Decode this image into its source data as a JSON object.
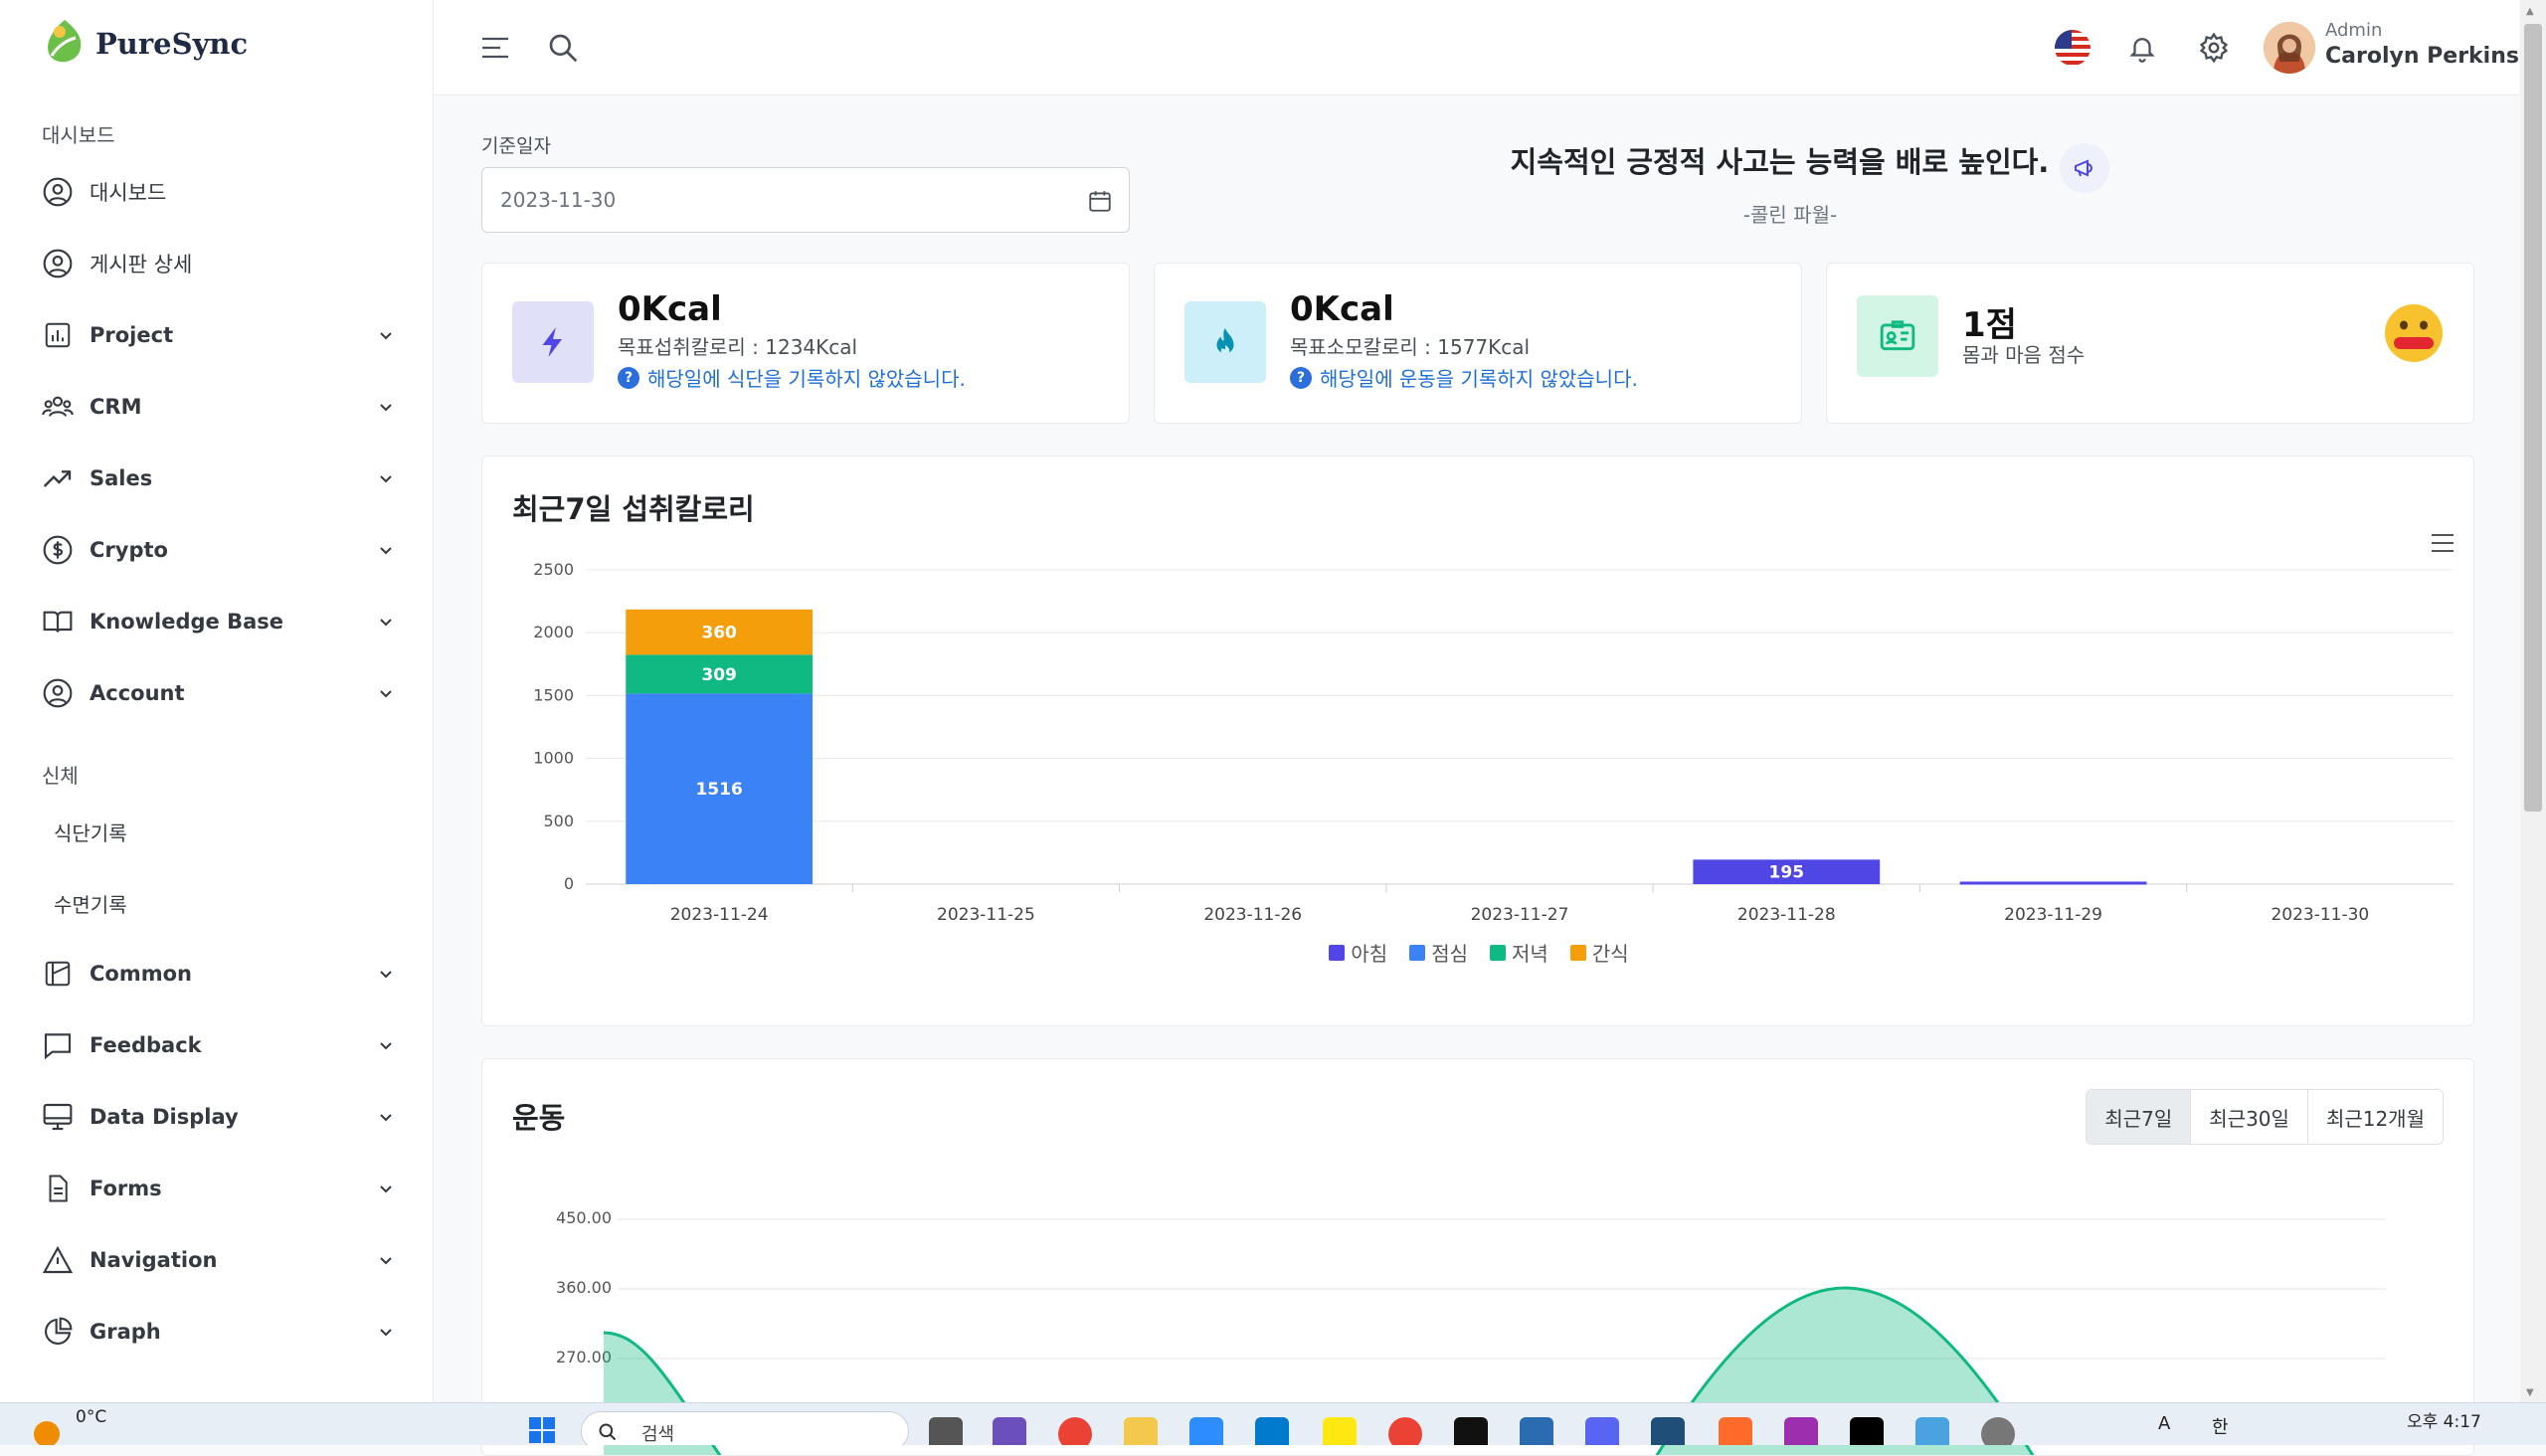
{
  "brand": {
    "name": "PureSync"
  },
  "sidebar": {
    "section1": "대시보드",
    "items1": [
      {
        "label": "대시보드"
      },
      {
        "label": "게시판 상세"
      },
      {
        "label": "Project"
      },
      {
        "label": "CRM"
      },
      {
        "label": "Sales"
      },
      {
        "label": "Crypto"
      },
      {
        "label": "Knowledge Base"
      },
      {
        "label": "Account"
      }
    ],
    "section2": "신체",
    "sub_items": [
      {
        "label": "식단기록"
      },
      {
        "label": "수면기록"
      }
    ],
    "items2": [
      {
        "label": "Common"
      },
      {
        "label": "Feedback"
      },
      {
        "label": "Data Display"
      },
      {
        "label": "Forms"
      },
      {
        "label": "Navigation"
      },
      {
        "label": "Graph"
      }
    ]
  },
  "header": {
    "user_role": "Admin",
    "user_name": "Carolyn Perkins",
    "icons": [
      "menu-icon",
      "search-icon",
      "us-flag-icon",
      "bell-icon",
      "gear-icon",
      "avatar"
    ]
  },
  "date_filter": {
    "label": "기준일자",
    "value": "2023-11-30"
  },
  "quote": {
    "text": "지속적인 긍정적 사고는 능력을 배로 높인다.",
    "author": "-콜린 파월-"
  },
  "stats": [
    {
      "value": "0Kcal",
      "sub": "목표섭취칼로리 : 1234Kcal",
      "warn": "해당일에 식단을 기록하지 않았습니다.",
      "accent": "#4f46e5"
    },
    {
      "value": "0Kcal",
      "sub": "목표소모칼로리 : 1577Kcal",
      "warn": "해당일에 운동을 기록하지 않았습니다.",
      "accent": "#0891b2"
    },
    {
      "value": "1점",
      "sub": "몸과 마음 점수",
      "accent": "#10b981"
    }
  ],
  "intake_chart": {
    "title": "최근7일 섭취칼로리",
    "legend": [
      "아침",
      "점심",
      "저녁",
      "간식"
    ],
    "colors": {
      "아침": "#4f46e5",
      "점심": "#3b82f6",
      "저녁": "#10b981",
      "간식": "#f59e0b"
    }
  },
  "exercise": {
    "title": "운동",
    "tabs": [
      "최근7일",
      "최근30일",
      "최근12개월"
    ],
    "active_tab": "최근7일",
    "y_ticks": [
      "450.00",
      "360.00",
      "270.00"
    ]
  },
  "taskbar": {
    "weather_temp": "0°C",
    "search": "검색",
    "time": "오후 4:17",
    "ime": "한",
    "ime2": "A"
  },
  "chart_data": [
    {
      "type": "bar",
      "title": "최근7일 섭취칼로리",
      "categories": [
        "2023-11-24",
        "2023-11-25",
        "2023-11-26",
        "2023-11-27",
        "2023-11-28",
        "2023-11-29",
        "2023-11-30"
      ],
      "series": [
        {
          "name": "아침",
          "values": [
            0,
            0,
            0,
            0,
            195,
            20,
            0
          ]
        },
        {
          "name": "점심",
          "values": [
            1516,
            0,
            0,
            0,
            0,
            0,
            0
          ]
        },
        {
          "name": "저녁",
          "values": [
            309,
            0,
            0,
            0,
            0,
            0,
            0
          ]
        },
        {
          "name": "간식",
          "values": [
            360,
            0,
            0,
            0,
            0,
            0,
            0
          ]
        }
      ],
      "stacked": true,
      "ylim": [
        0,
        2500
      ],
      "y_ticks": [
        0,
        500,
        1000,
        1500,
        2000,
        2500
      ],
      "legend_position": "bottom",
      "grid": true
    },
    {
      "type": "area",
      "title": "운동",
      "y_ticks": [
        450,
        360,
        270
      ],
      "ylim": [
        270,
        450
      ],
      "visible_partially": true
    }
  ]
}
